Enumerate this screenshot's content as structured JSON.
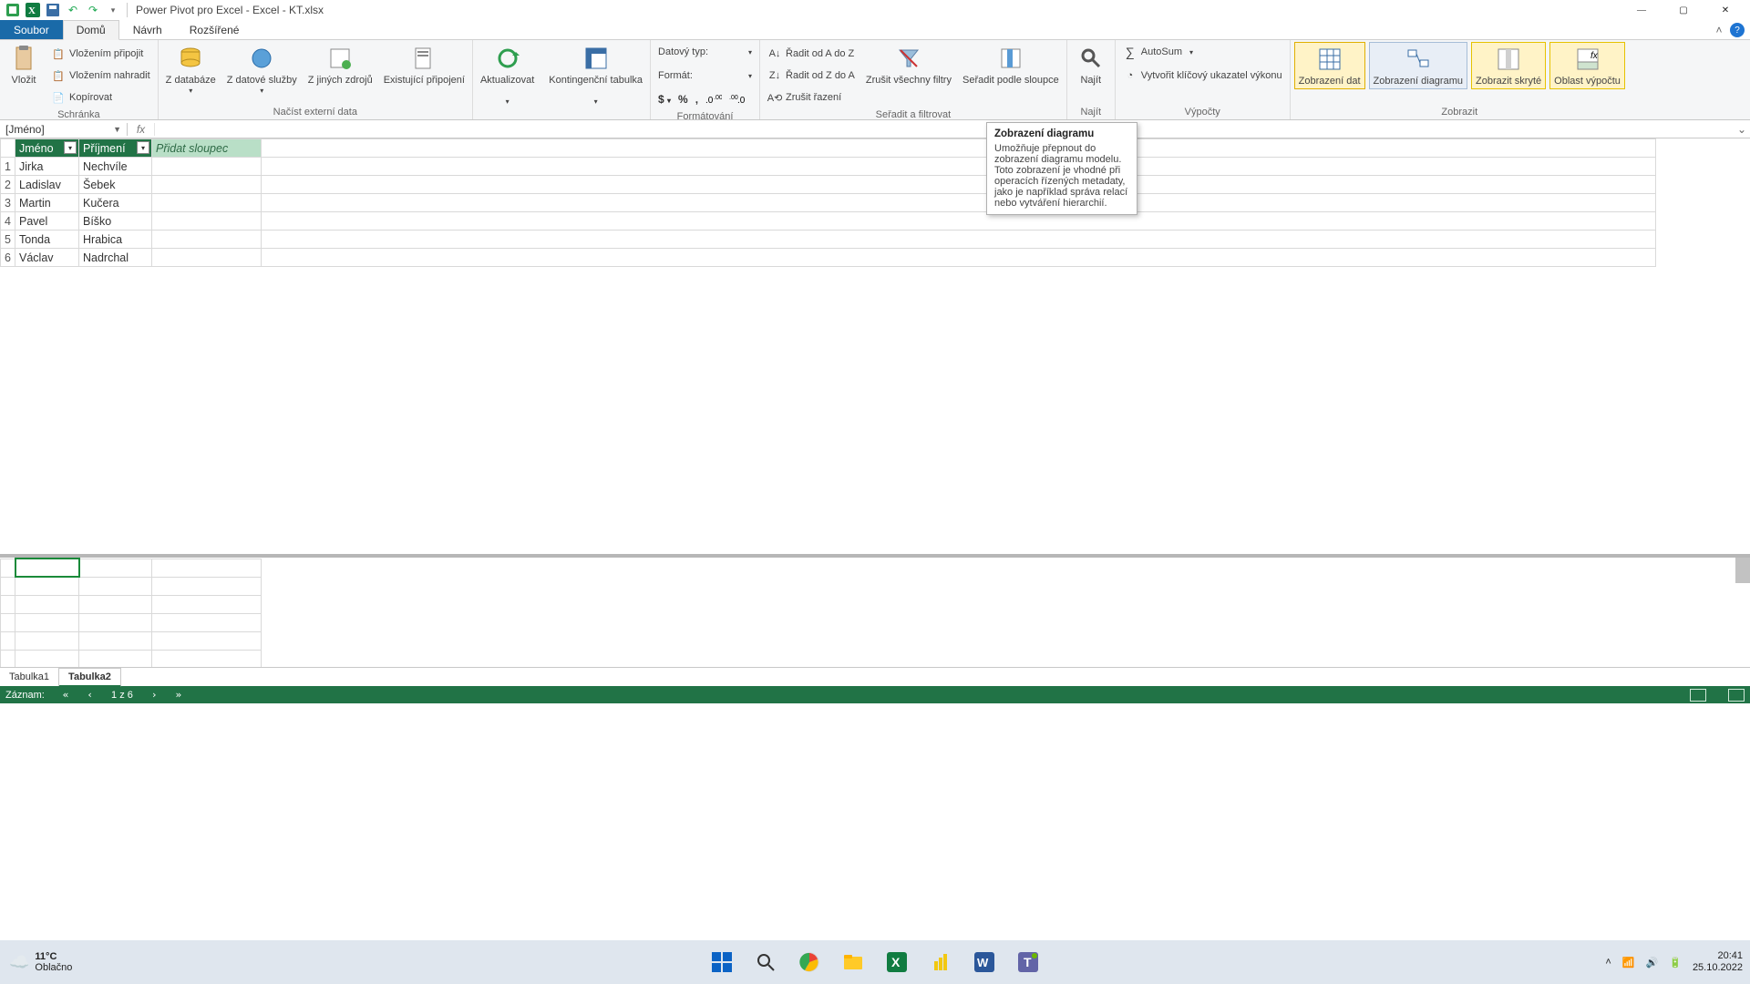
{
  "title": "Power Pivot pro Excel - Excel - KT.xlsx",
  "window_controls": {
    "min": "—",
    "max": "▢",
    "close": "✕"
  },
  "tabs": {
    "file": "Soubor",
    "home": "Domů",
    "design": "Návrh",
    "advanced": "Rozšířené"
  },
  "ribbon": {
    "clipboard": {
      "paste": "Vložit",
      "paste_append": "Vložením připojit",
      "paste_replace": "Vložením nahradit",
      "copy": "Kopírovat",
      "group": "Schránka"
    },
    "external": {
      "from_db": "Z databáze",
      "from_service": "Z datové služby",
      "from_other": "Z jiných zdrojů",
      "existing": "Existující připojení",
      "refresh": "Aktualizovat",
      "pivot": "Kontingenční tabulka",
      "group": "Načíst externí data"
    },
    "formatting": {
      "datatype": "Datový typ:",
      "format": "Formát:",
      "group": "Formátování"
    },
    "sort": {
      "az": "Řadit od A do Z",
      "za": "Řadit od Z do A",
      "clear": "Zrušit řazení",
      "clear_filters": "Zrušit všechny filtry",
      "by_col": "Seřadit podle sloupce",
      "group": "Seřadit a filtrovat"
    },
    "find": {
      "find": "Najít",
      "group": "Najít"
    },
    "calc": {
      "autosum": "AutoSum",
      "kpi": "Vytvořit klíčový ukazatel výkonu",
      "group": "Výpočty"
    },
    "view": {
      "data": "Zobrazení dat",
      "diagram": "Zobrazení diagramu",
      "hidden": "Zobrazit skryté",
      "calc_area": "Oblast výpočtu",
      "group": "Zobrazit"
    }
  },
  "namebox": "[Jméno]",
  "fx_label": "fx",
  "columns": {
    "c1": "Jméno",
    "c2": "Příjmení",
    "add": "Přidat sloupec"
  },
  "rows": [
    {
      "n": "1",
      "a": "Jirka",
      "b": "Nechvíle"
    },
    {
      "n": "2",
      "a": "Ladislav",
      "b": "Šebek"
    },
    {
      "n": "3",
      "a": "Martin",
      "b": "Kučera"
    },
    {
      "n": "4",
      "a": "Pavel",
      "b": "Bíško"
    },
    {
      "n": "5",
      "a": "Tonda",
      "b": "Hrabica"
    },
    {
      "n": "6",
      "a": "Václav",
      "b": "Nadrchal"
    }
  ],
  "sheets": {
    "t1": "Tabulka1",
    "t2": "Tabulka2"
  },
  "status": {
    "record": "Záznam:",
    "pos": "1 z 6"
  },
  "tooltip": {
    "title": "Zobrazení diagramu",
    "body": "Umožňuje přepnout do zobrazení diagramu modelu. Toto zobrazení je vhodné při operacích řízených metadaty, jako je například správa relací nebo vytváření hierarchií."
  },
  "taskbar": {
    "temp": "11°C",
    "cond": "Oblačno",
    "time": "20:41",
    "date": "25.10.2022"
  }
}
